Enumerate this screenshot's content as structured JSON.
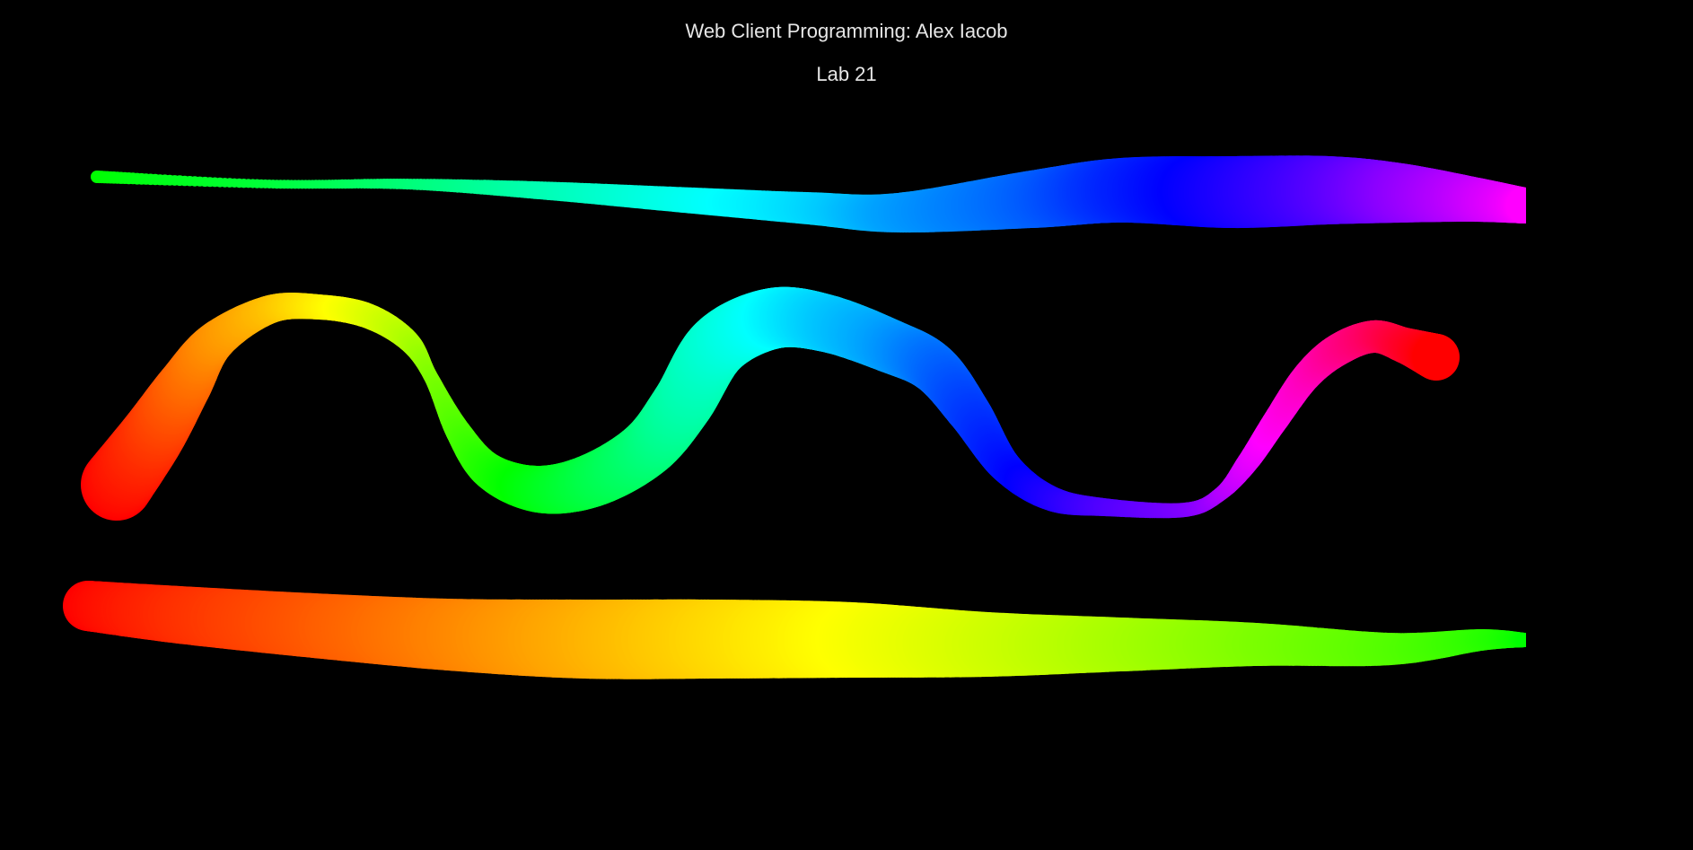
{
  "header": {
    "title": "Web Client Programming: Alex Iacob",
    "subtitle": "Lab 21"
  },
  "canvas": {
    "background": "#000000",
    "strokes": [
      {
        "name": "top-stroke",
        "hue_start": 120,
        "hue_end": 300
      },
      {
        "name": "middle-wave-stroke",
        "hue_start": 0,
        "hue_end": 360
      },
      {
        "name": "bottom-stroke",
        "hue_start": 0,
        "hue_end": 120
      }
    ]
  }
}
